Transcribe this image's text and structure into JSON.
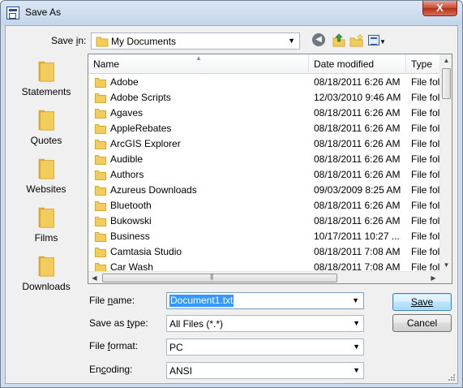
{
  "window": {
    "title": "Save As",
    "close_glyph": "X"
  },
  "toolbar": {
    "save_in_label": "Save in:",
    "save_in_value": "My Documents",
    "back_icon": "back-circle-icon",
    "up_icon": "up-folder-icon",
    "new_folder_icon": "new-folder-icon",
    "views_icon": "views-menu-icon"
  },
  "places": [
    {
      "label": "Statements"
    },
    {
      "label": "Quotes"
    },
    {
      "label": "Websites"
    },
    {
      "label": "Films"
    },
    {
      "label": "Downloads"
    }
  ],
  "list": {
    "columns": {
      "name": "Name",
      "date": "Date modified",
      "type": "Type"
    },
    "rows": [
      {
        "name": "Adobe",
        "date": "08/18/2011 6:26 AM",
        "type": "File fol"
      },
      {
        "name": "Adobe Scripts",
        "date": "12/03/2010 9:46 AM",
        "type": "File fol"
      },
      {
        "name": "Agaves",
        "date": "08/18/2011 6:26 AM",
        "type": "File fol"
      },
      {
        "name": "AppleRebates",
        "date": "08/18/2011 6:26 AM",
        "type": "File fol"
      },
      {
        "name": "ArcGIS Explorer",
        "date": "08/18/2011 6:26 AM",
        "type": "File fol"
      },
      {
        "name": "Audible",
        "date": "08/18/2011 6:26 AM",
        "type": "File fol"
      },
      {
        "name": "Authors",
        "date": "08/18/2011 6:26 AM",
        "type": "File fol"
      },
      {
        "name": "Azureus Downloads",
        "date": "09/03/2009 8:25 AM",
        "type": "File fol"
      },
      {
        "name": "Bluetooth",
        "date": "08/18/2011 6:26 AM",
        "type": "File fol"
      },
      {
        "name": "Bukowski",
        "date": "08/18/2011 6:26 AM",
        "type": "File fol"
      },
      {
        "name": "Business",
        "date": "10/17/2011 10:27 ...",
        "type": "File fol"
      },
      {
        "name": "Camtasia Studio",
        "date": "08/18/2011 7:08 AM",
        "type": "File fol"
      },
      {
        "name": "Car Wash",
        "date": "08/18/2011 7:08 AM",
        "type": "File fol"
      }
    ]
  },
  "form": {
    "file_name_label": "File name:",
    "file_name_value": "Document1.txt",
    "save_as_type_label": "Save as type:",
    "save_as_type_value": "All Files (*.*)",
    "file_format_label": "File format:",
    "file_format_value": "PC",
    "encoding_label": "Encoding:",
    "encoding_value": "ANSI"
  },
  "buttons": {
    "save": "Save",
    "cancel": "Cancel"
  },
  "colors": {
    "folder": "#f2cc5c",
    "folder_dark": "#d9a830",
    "selection": "#3399ff",
    "frame": "#cfdcec"
  }
}
